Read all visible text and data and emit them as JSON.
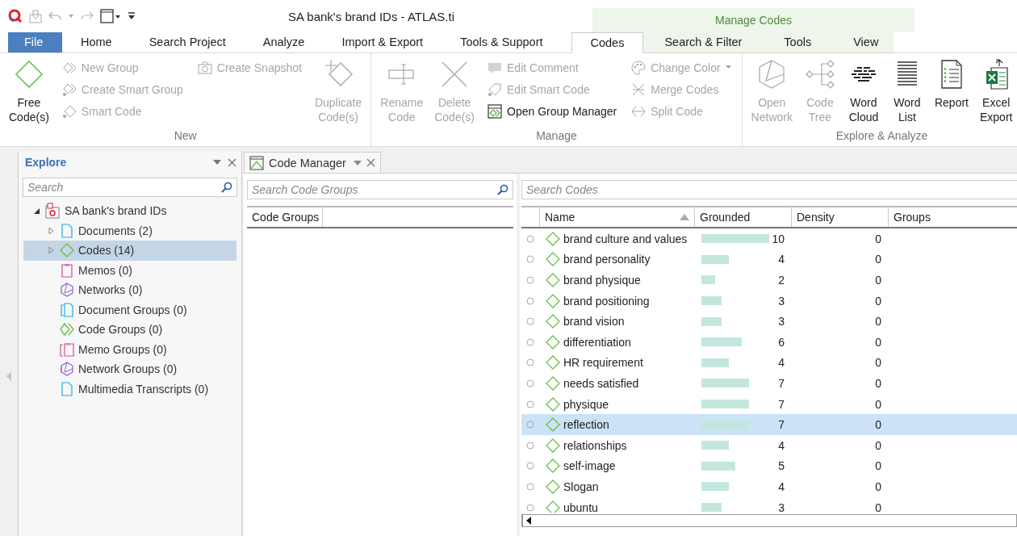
{
  "title_bar": {
    "title": "SA bank's brand IDs - ATLAS.ti"
  },
  "tabs": [
    {
      "label": "File",
      "kind": "file",
      "selected": false
    },
    {
      "label": "Home",
      "kind": "tab",
      "selected": false
    },
    {
      "label": "Search Project",
      "kind": "tab",
      "selected": false
    },
    {
      "label": "Analyze",
      "kind": "tab",
      "selected": false
    },
    {
      "label": "Import & Export",
      "kind": "tab",
      "selected": false
    },
    {
      "label": "Tools & Support",
      "kind": "tab",
      "selected": false
    }
  ],
  "context_tabs": {
    "label": "Manage Codes",
    "tabs": [
      {
        "label": "Codes",
        "selected": true
      },
      {
        "label": "Search & Filter",
        "selected": false
      },
      {
        "label": "Tools",
        "selected": false
      },
      {
        "label": "View",
        "selected": false
      }
    ]
  },
  "ribbon": {
    "groups": [
      {
        "label": "New",
        "columns": [
          {
            "kind": "large",
            "items": [
              {
                "label": "Free Code(s)",
                "disabled": false
              }
            ]
          },
          {
            "kind": "stack",
            "items": [
              {
                "label": "New Group",
                "disabled": true
              },
              {
                "label": "Create Smart Group",
                "disabled": true
              },
              {
                "label": "Smart Code",
                "disabled": true
              }
            ]
          },
          {
            "kind": "stack",
            "items": [
              {
                "label": "Create Snapshot",
                "disabled": true
              }
            ]
          },
          {
            "kind": "large",
            "items": [
              {
                "label": "Duplicate Code(s)",
                "disabled": true
              }
            ]
          }
        ]
      },
      {
        "label": "Manage",
        "columns": [
          {
            "kind": "large",
            "items": [
              {
                "label": "Rename Code",
                "disabled": true
              }
            ]
          },
          {
            "kind": "large",
            "items": [
              {
                "label": "Delete Code(s)",
                "disabled": true
              }
            ]
          },
          {
            "kind": "stack",
            "items": [
              {
                "label": "Edit Comment",
                "disabled": true
              },
              {
                "label": "Edit Smart Code",
                "disabled": true
              },
              {
                "label": "Open Group Manager",
                "disabled": false
              }
            ]
          },
          {
            "kind": "stack",
            "items": [
              {
                "label": "Change Color",
                "disabled": true,
                "dropdown": true
              },
              {
                "label": "Merge Codes",
                "disabled": true
              },
              {
                "label": "Split Code",
                "disabled": true
              }
            ]
          }
        ]
      },
      {
        "label": "Explore & Analyze",
        "columns": [
          {
            "kind": "large",
            "items": [
              {
                "label": "Open Network",
                "disabled": true
              }
            ]
          },
          {
            "kind": "large",
            "items": [
              {
                "label": "Code Tree",
                "disabled": true
              }
            ]
          },
          {
            "kind": "large",
            "items": [
              {
                "label": "Word Cloud",
                "disabled": false
              }
            ]
          },
          {
            "kind": "large",
            "items": [
              {
                "label": "Word List",
                "disabled": false
              }
            ]
          },
          {
            "kind": "large",
            "items": [
              {
                "label": "Report",
                "disabled": false
              }
            ]
          },
          {
            "kind": "large",
            "items": [
              {
                "label": "Excel Export",
                "disabled": false
              }
            ]
          }
        ]
      }
    ]
  },
  "explore": {
    "title": "Explore",
    "search": {
      "placeholder": "Search"
    },
    "tree": [
      {
        "label": "SA bank's brand IDs",
        "expanded": true,
        "selected": false,
        "children": [
          {
            "label": "Documents (2)",
            "expanded": false,
            "selected": false
          },
          {
            "label": "Codes (14)",
            "expanded": false,
            "selected": true
          },
          {
            "label": "Memos (0)",
            "selected": false
          },
          {
            "label": "Networks (0)",
            "selected": false
          },
          {
            "label": "Document Groups (0)",
            "selected": false
          },
          {
            "label": "Code Groups (0)",
            "selected": false
          },
          {
            "label": "Memo Groups (0)",
            "selected": false
          },
          {
            "label": "Network Groups (0)",
            "selected": false
          },
          {
            "label": "Multimedia Transcripts (0)",
            "selected": false
          }
        ]
      }
    ]
  },
  "code_manager": {
    "tab": "Code Manager",
    "groups_pane": {
      "search": {
        "placeholder": "Search Code Groups"
      },
      "column": "Code Groups"
    },
    "codes_pane": {
      "search": {
        "placeholder": "Search Codes"
      },
      "columns": [
        "Name",
        "Grounded",
        "Density",
        "Groups"
      ],
      "rows": [
        {
          "name": "brand culture and values",
          "grounded": "10",
          "density": "0",
          "selected": false
        },
        {
          "name": "brand personality",
          "grounded": "4",
          "density": "0",
          "selected": false
        },
        {
          "name": "brand physique",
          "grounded": "2",
          "density": "0",
          "selected": false
        },
        {
          "name": "brand positioning",
          "grounded": "3",
          "density": "0",
          "selected": false
        },
        {
          "name": "brand vision",
          "grounded": "3",
          "density": "0",
          "selected": false
        },
        {
          "name": "differentiation",
          "grounded": "6",
          "density": "0",
          "selected": false
        },
        {
          "name": "HR requirement",
          "grounded": "4",
          "density": "0",
          "selected": false
        },
        {
          "name": "needs satisfied",
          "grounded": "7",
          "density": "0",
          "selected": false
        },
        {
          "name": "physique",
          "grounded": "7",
          "density": "0",
          "selected": false
        },
        {
          "name": "reflection",
          "grounded": "7",
          "density": "0",
          "selected": true
        },
        {
          "name": "relationships",
          "grounded": "4",
          "density": "0",
          "selected": false
        },
        {
          "name": "self-image",
          "grounded": "5",
          "density": "0",
          "selected": false
        },
        {
          "name": "Slogan",
          "grounded": "4",
          "density": "0",
          "selected": false
        },
        {
          "name": "ubuntu",
          "grounded": "3",
          "density": "0",
          "selected": false
        }
      ]
    }
  }
}
